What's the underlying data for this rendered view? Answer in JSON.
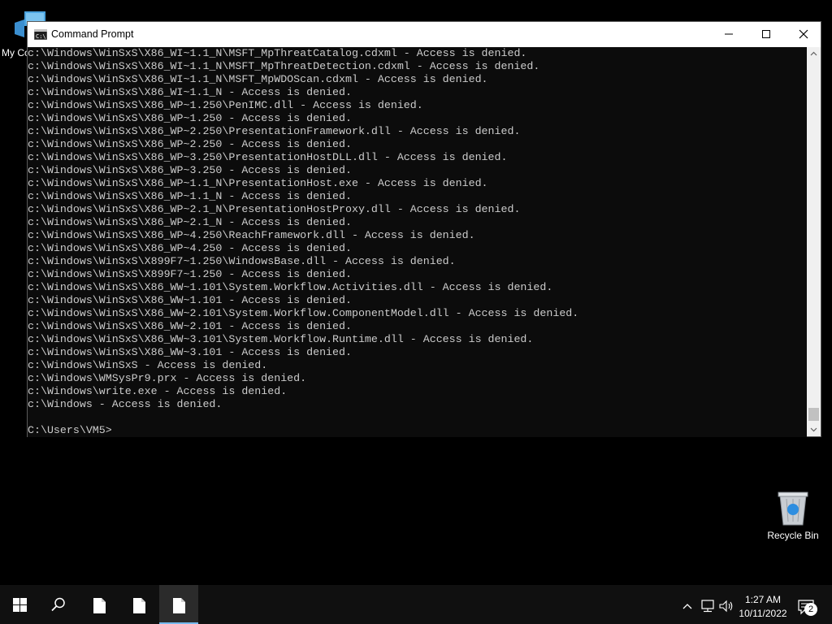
{
  "desktop": {
    "icons": {
      "my_computer_label": "My Co",
      "recycle_bin_label": "Recycle Bin"
    }
  },
  "window": {
    "title": "Command Prompt",
    "app_icon": "cmd-icon",
    "controls": {
      "minimize_icon": "minimize-icon",
      "maximize_icon": "maximize-icon",
      "close_icon": "close-icon"
    },
    "console_lines": [
      "c:\\Windows\\WinSxS\\X86_WI~1.1_N\\MSFT_MpThreatCatalog.cdxml - Access is denied.",
      "c:\\Windows\\WinSxS\\X86_WI~1.1_N\\MSFT_MpThreatDetection.cdxml - Access is denied.",
      "c:\\Windows\\WinSxS\\X86_WI~1.1_N\\MSFT_MpWDOScan.cdxml - Access is denied.",
      "c:\\Windows\\WinSxS\\X86_WI~1.1_N - Access is denied.",
      "c:\\Windows\\WinSxS\\X86_WP~1.250\\PenIMC.dll - Access is denied.",
      "c:\\Windows\\WinSxS\\X86_WP~1.250 - Access is denied.",
      "c:\\Windows\\WinSxS\\X86_WP~2.250\\PresentationFramework.dll - Access is denied.",
      "c:\\Windows\\WinSxS\\X86_WP~2.250 - Access is denied.",
      "c:\\Windows\\WinSxS\\X86_WP~3.250\\PresentationHostDLL.dll - Access is denied.",
      "c:\\Windows\\WinSxS\\X86_WP~3.250 - Access is denied.",
      "c:\\Windows\\WinSxS\\X86_WP~1.1_N\\PresentationHost.exe - Access is denied.",
      "c:\\Windows\\WinSxS\\X86_WP~1.1_N - Access is denied.",
      "c:\\Windows\\WinSxS\\X86_WP~2.1_N\\PresentationHostProxy.dll - Access is denied.",
      "c:\\Windows\\WinSxS\\X86_WP~2.1_N - Access is denied.",
      "c:\\Windows\\WinSxS\\X86_WP~4.250\\ReachFramework.dll - Access is denied.",
      "c:\\Windows\\WinSxS\\X86_WP~4.250 - Access is denied.",
      "c:\\Windows\\WinSxS\\X899F7~1.250\\WindowsBase.dll - Access is denied.",
      "c:\\Windows\\WinSxS\\X899F7~1.250 - Access is denied.",
      "c:\\Windows\\WinSxS\\X86_WW~1.101\\System.Workflow.Activities.dll - Access is denied.",
      "c:\\Windows\\WinSxS\\X86_WW~1.101 - Access is denied.",
      "c:\\Windows\\WinSxS\\X86_WW~2.101\\System.Workflow.ComponentModel.dll - Access is denied.",
      "c:\\Windows\\WinSxS\\X86_WW~2.101 - Access is denied.",
      "c:\\Windows\\WinSxS\\X86_WW~3.101\\System.Workflow.Runtime.dll - Access is denied.",
      "c:\\Windows\\WinSxS\\X86_WW~3.101 - Access is denied.",
      "c:\\Windows\\WinSxS - Access is denied.",
      "c:\\Windows\\WMSysPr9.prx - Access is denied.",
      "c:\\Windows\\write.exe - Access is denied.",
      "c:\\Windows - Access is denied.",
      "",
      "C:\\Users\\VM5>"
    ]
  },
  "taskbar": {
    "start_icon": "windows-logo-icon",
    "search_icon": "search-icon",
    "apps": [
      "document-icon",
      "document-icon",
      "document-icon"
    ],
    "tray": {
      "time": "1:27 AM",
      "date": "10/11/2022",
      "notification_count": "2"
    }
  },
  "colors": {
    "console_bg": "#0c0c0c",
    "console_fg": "#cccccc",
    "titlebar_bg": "#ffffff",
    "taskbar_bg": "#101010",
    "active_accent": "#76b9ed"
  }
}
